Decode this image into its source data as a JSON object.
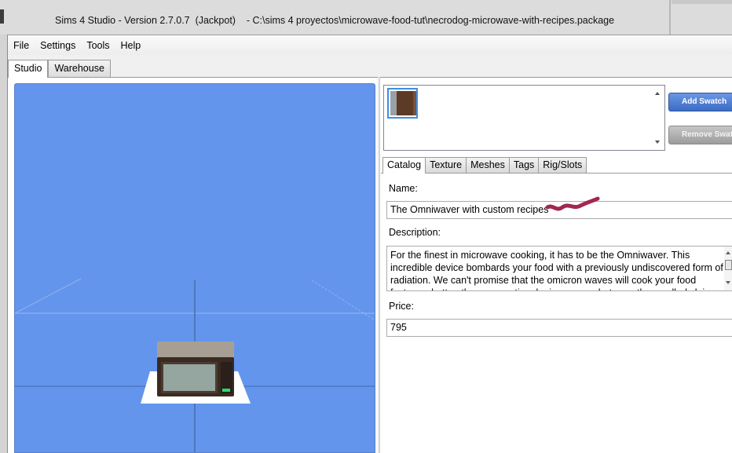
{
  "window": {
    "title": "Sims 4 Studio - Version 2.7.0.7  (Jackpot)    - C:\\sims 4 proyectos\\microwave-food-tut\\necrodog-microwave-with-recipes.package"
  },
  "menu": [
    "File",
    "Settings",
    "Tools",
    "Help"
  ],
  "main_tabs": [
    {
      "label": "Studio",
      "active": true
    },
    {
      "label": "Warehouse",
      "active": false
    }
  ],
  "swatches": {
    "add_label": "Add Swatch",
    "remove_label": "Remove Swatch"
  },
  "sub_tabs": [
    {
      "label": "Catalog",
      "active": true
    },
    {
      "label": "Texture",
      "active": false
    },
    {
      "label": "Meshes",
      "active": false
    },
    {
      "label": "Tags",
      "active": false
    },
    {
      "label": "Rig/Slots",
      "active": false
    }
  ],
  "catalog": {
    "name_label": "Name:",
    "name_value": "The Omniwaver with custom recipes",
    "description_label": "Description:",
    "description_value": "For the finest in microwave cooking, it has to be the Omniwaver. This incredible device bombards your food with a previously undiscovered form of radiation. We can't promise that the omicron waves will cook your food faster, or hotter, than conventional microwaves, but our other scalled claims at the five",
    "price_label": "Price:",
    "price_value": "795"
  },
  "colors": {
    "viewport_bg": "#6495ed",
    "selected_swatch": "#3b8fe4",
    "scribble": "#a0284e"
  }
}
